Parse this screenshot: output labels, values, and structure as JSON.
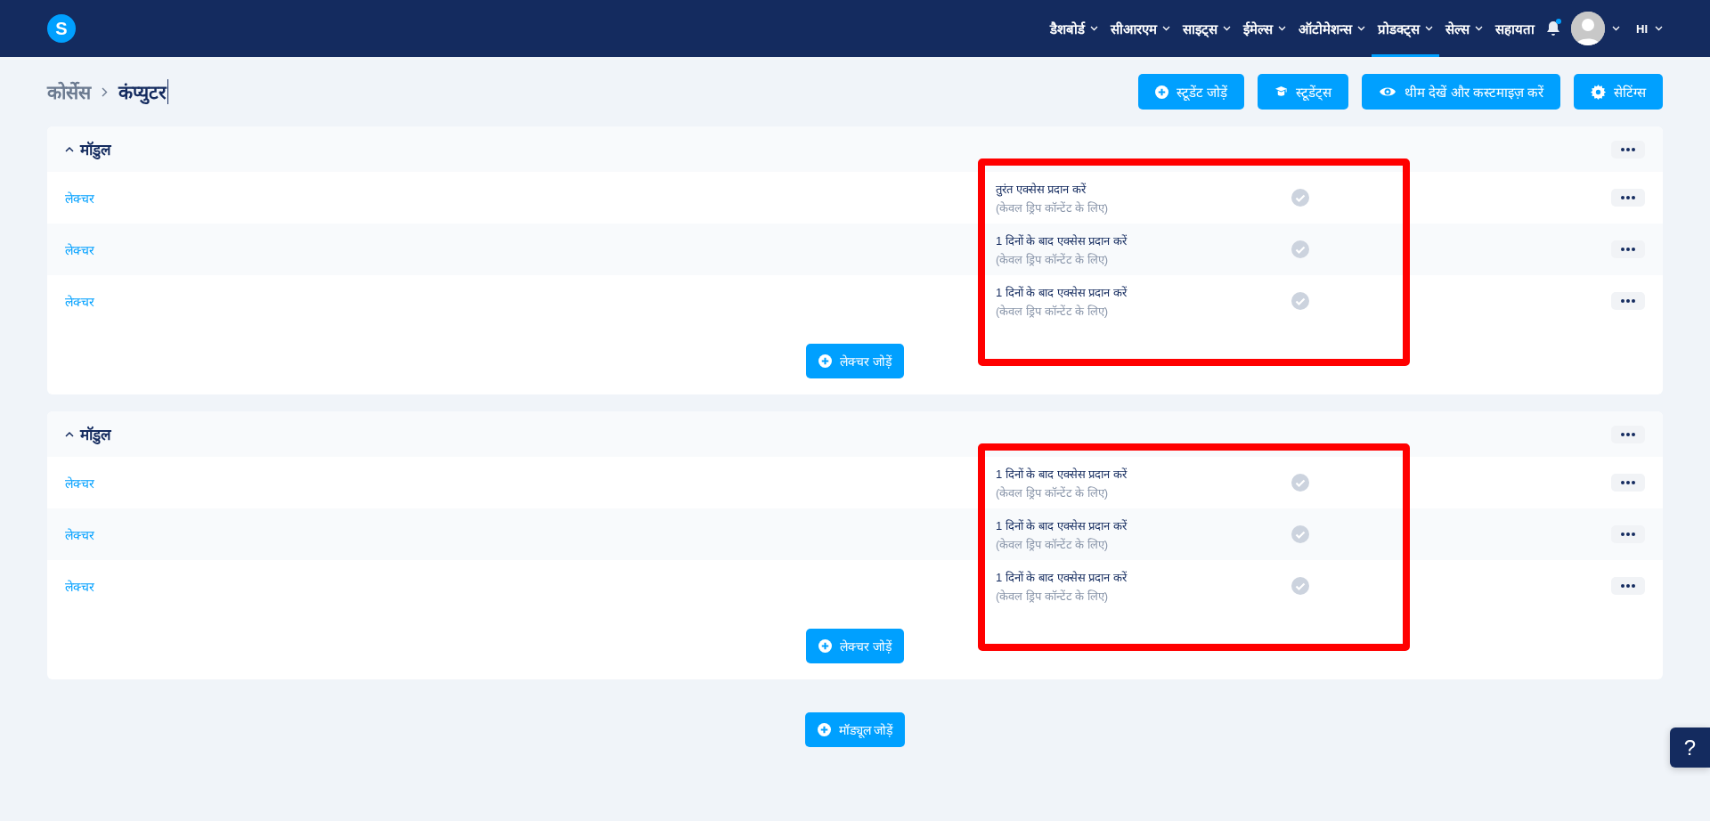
{
  "nav": {
    "logo": "S",
    "items": [
      {
        "label": "डैशबोर्ड",
        "selected": false,
        "dropdown": true
      },
      {
        "label": "सीआरएम",
        "selected": false,
        "dropdown": true
      },
      {
        "label": "साइट्स",
        "selected": false,
        "dropdown": true
      },
      {
        "label": "ईमेल्स",
        "selected": false,
        "dropdown": true
      },
      {
        "label": "ऑटोमेशन्स",
        "selected": false,
        "dropdown": true
      },
      {
        "label": "प्रोडक्ट्स",
        "selected": true,
        "dropdown": true
      },
      {
        "label": "सेल्स",
        "selected": false,
        "dropdown": true
      },
      {
        "label": "सहायता",
        "selected": false,
        "dropdown": false
      }
    ],
    "notifications_unread": true,
    "language": "HI"
  },
  "breadcrumb": [
    {
      "label": "कोर्सेस"
    },
    {
      "label": "कंप्युटर"
    }
  ],
  "actions": [
    {
      "label": "स्टूडेंट जोड़ें"
    },
    {
      "label": "स्टूडेंट्स"
    },
    {
      "label": "थीम देखें और कस्टमाइज़ करें"
    },
    {
      "label": "सेटिंग्स"
    }
  ],
  "modules": [
    {
      "title": "मॉडुल",
      "expanded": true,
      "highlighted": true,
      "add_lecture": "लेक्चर जोड़ें",
      "lectures": [
        {
          "title": "लेक्चर",
          "access": "तुरंत एक्सेस प्रदान करें",
          "note": "(केवल ड्रिप कॉन्टेंट के लिए)"
        },
        {
          "title": "लेक्चर",
          "access": "1 दिनों के बाद एक्सेस प्रदान करें",
          "note": "(केवल ड्रिप कॉन्टेंट के लिए)"
        },
        {
          "title": "लेक्चर",
          "access": "1 दिनों के बाद एक्सेस प्रदान करें",
          "note": "(केवल ड्रिप कॉन्टेंट के लिए)"
        }
      ]
    },
    {
      "title": "मॉडुल",
      "expanded": true,
      "highlighted": true,
      "add_lecture": "लेक्चर जोड़ें",
      "lectures": [
        {
          "title": "लेक्चर",
          "access": "1 दिनों के बाद एक्सेस प्रदान करें",
          "note": "(केवल ड्रिप कॉन्टेंट के लिए)"
        },
        {
          "title": "लेक्चर",
          "access": "1 दिनों के बाद एक्सेस प्रदान करें",
          "note": "(केवल ड्रिप कॉन्टेंट के लिए)"
        },
        {
          "title": "लेक्चर",
          "access": "1 दिनों के बाद एक्सेस प्रदान करें",
          "note": "(केवल ड्रिप कॉन्टेंट के लिए)"
        }
      ]
    }
  ],
  "add_module": "मॉड्यूल जोड़ें",
  "help": "?"
}
